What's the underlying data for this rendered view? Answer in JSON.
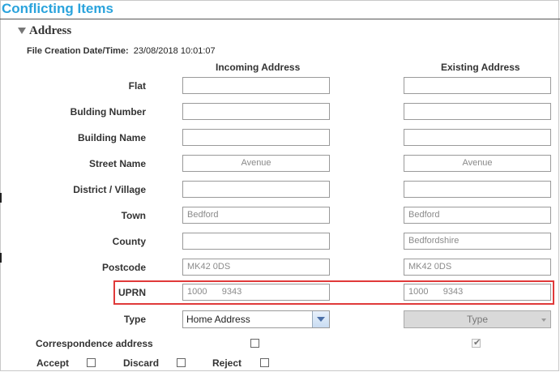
{
  "window": {
    "title": "Conflicting Items"
  },
  "section": {
    "title": "Address"
  },
  "meta": {
    "file_creation_label": "File Creation Date/Time:",
    "file_creation_value": "23/08/2018 10:01:07"
  },
  "columns": {
    "incoming": "Incoming Address",
    "existing": "Existing Address"
  },
  "rows": [
    {
      "label": "Flat",
      "incoming": "",
      "existing": ""
    },
    {
      "label": "Bulding Number",
      "incoming": "",
      "existing": ""
    },
    {
      "label": "Building Name",
      "incoming": "",
      "existing": ""
    },
    {
      "label": "Street Name",
      "incoming": "Avenue",
      "existing": "Avenue"
    },
    {
      "label": "District / Village",
      "incoming": "",
      "existing": ""
    },
    {
      "label": "Town",
      "incoming": "Bedford",
      "existing": "Bedford"
    },
    {
      "label": "County",
      "incoming": "",
      "existing": "Bedfordshire"
    },
    {
      "label": "Postcode",
      "incoming": "MK42 0DS",
      "existing": "MK42 0DS"
    },
    {
      "label": "UPRN",
      "incoming": "1000      9343",
      "existing": "1000      9343"
    }
  ],
  "type": {
    "label": "Type",
    "incoming_value": "Home Address",
    "existing_placeholder": "Type"
  },
  "correspondence": {
    "label": "Correspondence address",
    "incoming_checked": false,
    "existing_checked": true
  },
  "actions": {
    "accept": "Accept",
    "discard": "Discard",
    "reject": "Reject"
  },
  "colors": {
    "title": "#2aa3dc",
    "highlight": "#e03a3a"
  }
}
